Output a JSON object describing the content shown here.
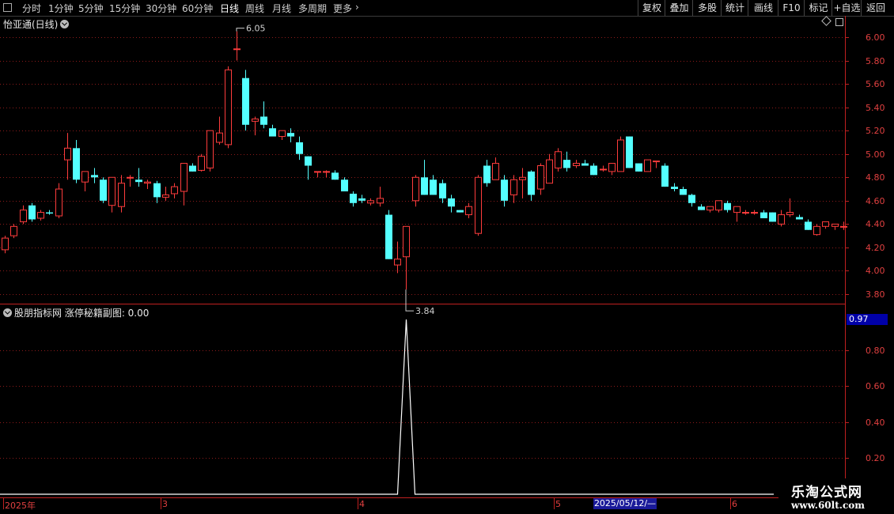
{
  "toolbar": {
    "periods": [
      {
        "label": "分时",
        "x": 30
      },
      {
        "label": "1分钟",
        "x": 63
      },
      {
        "label": "5分钟",
        "x": 101
      },
      {
        "label": "15分钟",
        "x": 140
      },
      {
        "label": "30分钟",
        "x": 186
      },
      {
        "label": "60分钟",
        "x": 232
      },
      {
        "label": "日线",
        "x": 280,
        "active": true
      },
      {
        "label": "周线",
        "x": 312
      },
      {
        "label": "月线",
        "x": 346
      },
      {
        "label": "多周期",
        "x": 379
      },
      {
        "label": "更多",
        "x": 423
      }
    ],
    "more_arrow": "›",
    "right_buttons": [
      "复权",
      "叠加",
      "多股",
      "统计",
      "画线",
      "F10",
      "标记",
      "+自选",
      "返回"
    ]
  },
  "main_chart": {
    "stock_title": "怡亚通(日线)",
    "high_label": "6.05",
    "low_label": "3.84",
    "y_ticks": [
      "6.00",
      "5.80",
      "5.60",
      "5.40",
      "5.20",
      "5.00",
      "4.80",
      "4.60",
      "4.40",
      "4.20",
      "4.00",
      "3.80"
    ]
  },
  "sub_chart": {
    "title": "股朋指标网 涨停秘籍副图: 0.00",
    "badge_value": "0.97",
    "y_ticks": [
      "0.80",
      "0.60",
      "0.40",
      "0.20"
    ]
  },
  "date_axis": {
    "labels": [
      "2025年",
      "3",
      "4",
      "5",
      "6"
    ],
    "cursor_date": "2025/05/12/—"
  },
  "watermark": {
    "title": "乐淘公式网",
    "url": "www.60lt.com"
  },
  "colors": {
    "up": "#ff3c3c",
    "down": "#54ffff",
    "axis": "#c02020",
    "grid": "#8b1a1a"
  },
  "chart_data": [
    {
      "type": "candlestick",
      "title": "怡亚通(日线)",
      "ylim": [
        3.75,
        6.12
      ],
      "candles": [
        [
          4.18,
          4.3,
          4.15,
          4.28
        ],
        [
          4.3,
          4.4,
          4.28,
          4.38
        ],
        [
          4.42,
          4.56,
          4.4,
          4.52
        ],
        [
          4.56,
          4.58,
          4.42,
          4.44
        ],
        [
          4.45,
          4.52,
          4.43,
          4.5
        ],
        [
          4.5,
          4.52,
          4.48,
          4.49
        ],
        [
          4.47,
          4.75,
          4.45,
          4.7
        ],
        [
          4.95,
          5.18,
          4.78,
          5.05
        ],
        [
          5.05,
          5.12,
          4.75,
          4.78
        ],
        [
          4.76,
          4.82,
          4.68,
          4.85
        ],
        [
          4.82,
          4.88,
          4.75,
          4.8
        ],
        [
          4.78,
          4.8,
          4.58,
          4.6
        ],
        [
          4.56,
          4.8,
          4.5,
          4.8
        ],
        [
          4.55,
          4.82,
          4.5,
          4.75
        ],
        [
          4.8,
          4.82,
          4.72,
          4.8
        ],
        [
          4.78,
          4.88,
          4.72,
          4.76
        ],
        [
          4.75,
          4.78,
          4.7,
          4.76
        ],
        [
          4.75,
          4.77,
          4.58,
          4.63
        ],
        [
          4.63,
          4.72,
          4.6,
          4.65
        ],
        [
          4.66,
          4.75,
          4.62,
          4.72
        ],
        [
          4.68,
          4.92,
          4.56,
          4.92
        ],
        [
          4.9,
          4.92,
          4.85,
          4.85
        ],
        [
          4.86,
          5.0,
          4.85,
          4.98
        ],
        [
          4.88,
          5.05,
          4.85,
          5.2
        ],
        [
          5.1,
          5.32,
          5.08,
          5.18
        ],
        [
          5.08,
          5.75,
          5.05,
          5.72
        ],
        [
          5.9,
          6.05,
          5.8,
          5.9
        ],
        [
          5.65,
          5.72,
          5.2,
          5.25
        ],
        [
          5.28,
          5.32,
          5.16,
          5.3
        ],
        [
          5.32,
          5.45,
          5.22,
          5.25
        ],
        [
          5.22,
          5.25,
          5.18,
          5.15
        ],
        [
          5.15,
          5.2,
          5.12,
          5.2
        ],
        [
          5.18,
          5.22,
          5.1,
          5.15
        ],
        [
          5.1,
          5.15,
          4.95,
          5.0
        ],
        [
          4.98,
          4.98,
          4.78,
          4.9
        ],
        [
          4.85,
          4.85,
          4.8,
          4.85
        ],
        [
          4.85,
          4.86,
          4.8,
          4.85
        ],
        [
          4.84,
          4.86,
          4.78,
          4.78
        ],
        [
          4.78,
          4.8,
          4.68,
          4.68
        ],
        [
          4.66,
          4.68,
          4.55,
          4.58
        ],
        [
          4.62,
          4.65,
          4.58,
          4.6
        ],
        [
          4.58,
          4.62,
          4.56,
          4.6
        ],
        [
          4.58,
          4.72,
          4.55,
          4.62
        ],
        [
          4.48,
          4.52,
          4.1,
          4.1
        ],
        [
          4.05,
          4.25,
          3.98,
          4.1
        ],
        [
          4.12,
          4.38,
          3.84,
          4.38
        ],
        [
          4.6,
          4.82,
          4.55,
          4.8
        ],
        [
          4.8,
          4.95,
          4.65,
          4.65
        ],
        [
          4.78,
          4.82,
          4.65,
          4.65
        ],
        [
          4.75,
          4.78,
          4.58,
          4.62
        ],
        [
          4.62,
          4.65,
          4.5,
          4.55
        ],
        [
          4.52,
          4.52,
          4.5,
          4.5
        ],
        [
          4.48,
          4.58,
          4.45,
          4.55
        ],
        [
          4.32,
          4.82,
          4.3,
          4.8
        ],
        [
          4.9,
          4.95,
          4.72,
          4.75
        ],
        [
          4.78,
          4.97,
          4.78,
          4.92
        ],
        [
          4.78,
          4.82,
          4.55,
          4.6
        ],
        [
          4.65,
          4.82,
          4.58,
          4.78
        ],
        [
          4.78,
          4.88,
          4.62,
          4.8
        ],
        [
          4.85,
          4.86,
          4.6,
          4.65
        ],
        [
          4.7,
          4.92,
          4.65,
          4.9
        ],
        [
          4.75,
          5.0,
          4.75,
          4.95
        ],
        [
          4.88,
          5.05,
          4.85,
          5.02
        ],
        [
          4.95,
          5.02,
          4.85,
          4.88
        ],
        [
          4.9,
          4.95,
          4.88,
          4.92
        ],
        [
          4.92,
          4.95,
          4.9,
          4.9
        ],
        [
          4.9,
          4.92,
          4.82,
          4.82
        ],
        [
          4.87,
          4.9,
          4.85,
          4.87
        ],
        [
          4.85,
          4.92,
          4.82,
          4.92
        ],
        [
          4.85,
          5.15,
          4.85,
          5.12
        ],
        [
          5.15,
          5.15,
          4.88,
          4.88
        ],
        [
          4.92,
          4.92,
          4.85,
          4.85
        ],
        [
          4.85,
          4.95,
          4.85,
          4.95
        ],
        [
          4.94,
          4.94,
          4.88,
          4.94
        ],
        [
          4.9,
          4.92,
          4.72,
          4.72
        ],
        [
          4.72,
          4.75,
          4.68,
          4.7
        ],
        [
          4.7,
          4.72,
          4.65,
          4.65
        ],
        [
          4.65,
          4.66,
          4.55,
          4.58
        ],
        [
          4.55,
          4.57,
          4.52,
          4.52
        ],
        [
          4.52,
          4.55,
          4.5,
          4.55
        ],
        [
          4.52,
          4.6,
          4.5,
          4.6
        ],
        [
          4.58,
          4.6,
          4.5,
          4.52
        ],
        [
          4.5,
          4.55,
          4.42,
          4.55
        ],
        [
          4.5,
          4.52,
          4.48,
          4.5
        ],
        [
          4.5,
          4.52,
          4.48,
          4.5
        ],
        [
          4.5,
          4.52,
          4.45,
          4.45
        ],
        [
          4.5,
          4.5,
          4.42,
          4.42
        ],
        [
          4.4,
          4.52,
          4.38,
          4.48
        ],
        [
          4.48,
          4.62,
          4.46,
          4.5
        ],
        [
          4.46,
          4.48,
          4.44,
          4.44
        ],
        [
          4.42,
          4.44,
          4.35,
          4.35
        ],
        [
          4.31,
          4.4,
          4.3,
          4.38
        ],
        [
          4.38,
          4.42,
          4.36,
          4.42
        ],
        [
          4.38,
          4.4,
          4.35,
          4.4
        ],
        [
          4.38,
          4.42,
          4.35,
          4.38
        ]
      ]
    },
    {
      "type": "line",
      "title": "股朋指标网 涨停秘籍副图",
      "ylim": [
        0,
        1
      ],
      "series": [
        {
          "spike_index": 45,
          "spike_value": 0.97,
          "baseline": 0.0
        }
      ]
    }
  ]
}
